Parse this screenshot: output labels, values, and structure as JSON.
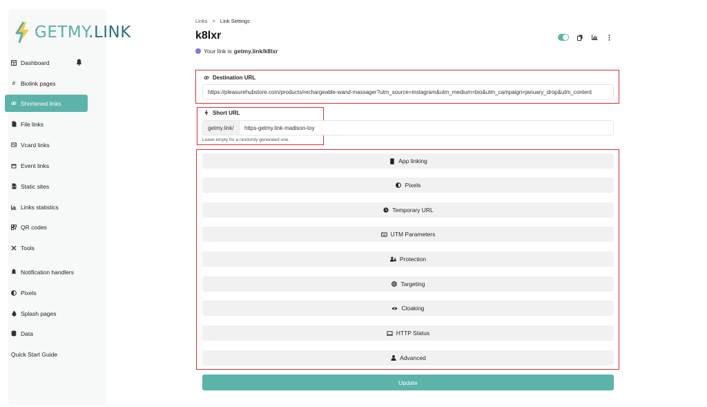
{
  "brand": {
    "logo_text_a": "GETMY",
    "logo_text_b": ".LINK"
  },
  "sidebar": {
    "items": [
      {
        "label": "Dashboard",
        "icon": "table-icon"
      },
      {
        "label": "Biolink pages",
        "icon": "hash-icon"
      },
      {
        "label": "Shortened links",
        "icon": "link-icon",
        "active": true
      },
      {
        "label": "File links",
        "icon": "file-icon"
      },
      {
        "label": "Vcard links",
        "icon": "vcard-icon"
      },
      {
        "label": "Event links",
        "icon": "calendar-icon"
      },
      {
        "label": "Static sites",
        "icon": "file-code-icon"
      },
      {
        "label": "Links statistics",
        "icon": "bar-chart-icon"
      },
      {
        "label": "QR codes",
        "icon": "qrcode-icon"
      },
      {
        "label": "Tools",
        "icon": "tools-icon"
      },
      {
        "label": "Notification handlers",
        "icon": "bell-icon"
      },
      {
        "label": "Pixels",
        "icon": "adjust-icon"
      },
      {
        "label": "Splash pages",
        "icon": "droplet-icon"
      },
      {
        "label": "Data",
        "icon": "database-icon"
      }
    ],
    "quick_start": "Quick Start Guide"
  },
  "breadcrumb": {
    "parent": "Links",
    "separator": ">",
    "current": "Link Settings"
  },
  "page": {
    "title": "k8lxr",
    "your_link_prefix": "Your link is",
    "your_link_value": "getmy.link/k8lxr",
    "status_dot_color": "#8b6fe6"
  },
  "form": {
    "destination": {
      "label": "Destination URL",
      "value": "https://pleasurehubstore.com/products/rechargeable-wand-massager?utm_source=instagram&utm_medium=bio&utm_campaign=january_drop&utm_content"
    },
    "short_url": {
      "label": "Short URL",
      "prefix": "getmy.link/",
      "value": "https-getmy.link-madison-toy",
      "hint": "Leave empty for a randomly generated one."
    },
    "sections": [
      {
        "label": "App linking",
        "icon": "mobile-icon"
      },
      {
        "label": "Pixels",
        "icon": "adjust-icon"
      },
      {
        "label": "Temporary URL",
        "icon": "clock-icon"
      },
      {
        "label": "UTM Parameters",
        "icon": "keyboard-icon"
      },
      {
        "label": "Protection",
        "icon": "user-lock-icon"
      },
      {
        "label": "Targeting",
        "icon": "crosshair-icon"
      },
      {
        "label": "Cloaking",
        "icon": "eye-icon"
      },
      {
        "label": "HTTP Status",
        "icon": "server-icon"
      },
      {
        "label": "Advanced",
        "icon": "user-cog-icon"
      }
    ],
    "submit_label": "Update"
  },
  "colors": {
    "accent": "#5cb3a9",
    "highlight_border": "#d32f2f"
  }
}
